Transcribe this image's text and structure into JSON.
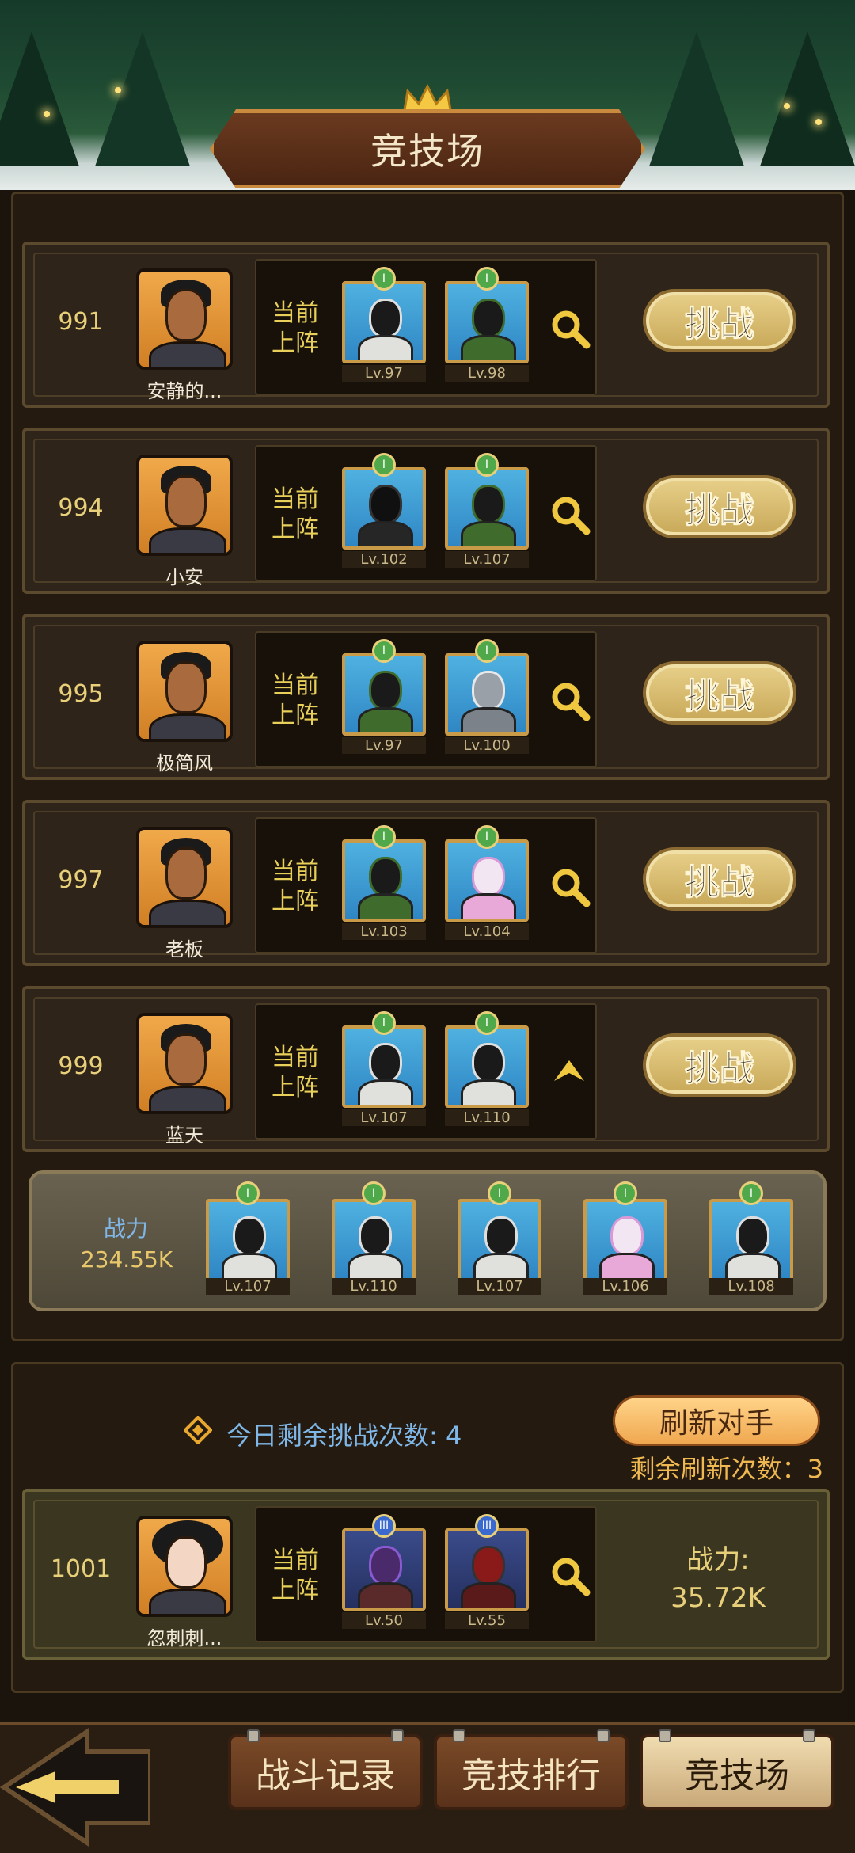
{
  "header": {
    "title": "竞技场"
  },
  "rows": [
    {
      "rank": "991",
      "name": "安静的...",
      "team_label_1": "当前",
      "team_label_2": "上阵",
      "heroes": [
        {
          "lv": "Lv.97",
          "style": ""
        },
        {
          "lv": "Lv.98",
          "style": "green"
        }
      ],
      "action_icon": "search-icon",
      "challenge_label": "挑战"
    },
    {
      "rank": "994",
      "name": "小安",
      "team_label_1": "当前",
      "team_label_2": "上阵",
      "heroes": [
        {
          "lv": "Lv.102",
          "style": "dark"
        },
        {
          "lv": "Lv.107",
          "style": "green"
        }
      ],
      "action_icon": "search-icon",
      "challenge_label": "挑战"
    },
    {
      "rank": "995",
      "name": "极简风",
      "team_label_1": "当前",
      "team_label_2": "上阵",
      "heroes": [
        {
          "lv": "Lv.97",
          "style": "green"
        },
        {
          "lv": "Lv.100",
          "style": "wolf"
        }
      ],
      "action_icon": "search-icon",
      "challenge_label": "挑战"
    },
    {
      "rank": "997",
      "name": "老板",
      "team_label_1": "当前",
      "team_label_2": "上阵",
      "heroes": [
        {
          "lv": "Lv.103",
          "style": "green"
        },
        {
          "lv": "Lv.104",
          "style": "pink"
        }
      ],
      "action_icon": "search-icon",
      "challenge_label": "挑战"
    },
    {
      "rank": "999",
      "name": "蓝天",
      "team_label_1": "当前",
      "team_label_2": "上阵",
      "heroes": [
        {
          "lv": "Lv.107",
          "style": ""
        },
        {
          "lv": "Lv.110",
          "style": ""
        }
      ],
      "action_icon": "chevron-up-icon",
      "challenge_label": "挑战"
    }
  ],
  "expanded_team": {
    "power_label": "战力",
    "power_value": "234.55K",
    "heroes": [
      {
        "lv": "Lv.107"
      },
      {
        "lv": "Lv.110"
      },
      {
        "lv": "Lv.107"
      },
      {
        "lv": "Lv.106"
      },
      {
        "lv": "Lv.108"
      }
    ]
  },
  "remaining": {
    "text": "今日剩余挑战次数: 4"
  },
  "refresh": {
    "button_label": "刷新对手",
    "count_text": "剩余刷新次数：3"
  },
  "self": {
    "rank": "1001",
    "name": "忽刺刺...",
    "team_label_1": "当前",
    "team_label_2": "上阵",
    "heroes": [
      {
        "lv": "Lv.50"
      },
      {
        "lv": "Lv.55"
      }
    ],
    "power_label": "战力:",
    "power_value": "35.72K"
  },
  "nav": {
    "tabs": [
      "战斗记录",
      "竞技排行",
      "竞技场"
    ],
    "active_tab": "竞技场"
  },
  "colors": {
    "gold": "#e8cf7a",
    "blue_text": "#7fb8e8",
    "orange_text": "#f0b850",
    "button": "#e8d08a"
  }
}
